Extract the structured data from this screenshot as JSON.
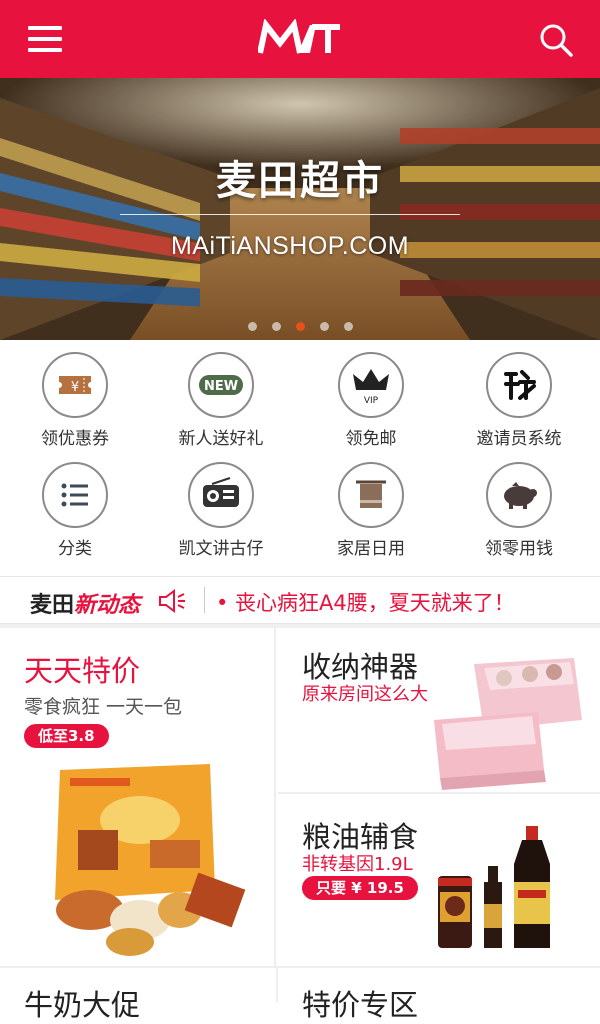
{
  "header": {
    "brand_color": "#e8123e",
    "logo_text": "MAT",
    "menu_icon": "hamburger-icon",
    "search_icon": "search-icon"
  },
  "banner": {
    "title": "麦田超市",
    "subtitle": "MAiTiANSHOP.COM",
    "active_slide": 3,
    "slide_count": 5
  },
  "grid": {
    "items": [
      {
        "label": "领优惠券",
        "icon": "coupon-icon"
      },
      {
        "label": "新人送好礼",
        "icon": "new-badge-icon"
      },
      {
        "label": "领免邮",
        "icon": "vip-crown-icon"
      },
      {
        "label": "邀请员系统",
        "icon": "invite-icon"
      },
      {
        "label": "分类",
        "icon": "list-icon"
      },
      {
        "label": "凯文讲古仔",
        "icon": "radio-icon"
      },
      {
        "label": "家居日用",
        "icon": "towel-icon"
      },
      {
        "label": "领零用钱",
        "icon": "piggy-bank-icon"
      }
    ]
  },
  "news": {
    "brand_black": "麦田",
    "brand_red": "新动态",
    "headline": "• 丧心病狂A4腰，夏天就来了！"
  },
  "promos": {
    "left": {
      "title": "天天特价",
      "subtitle": "零食疯狂 一天一包",
      "badge": "低至3.8"
    },
    "right_top": {
      "title": "收纳神器",
      "subtitle": "原来房间这么大"
    },
    "right_bottom": {
      "title": "粮油辅食",
      "subtitle": "非转基因1.9L",
      "badge": "只要 ¥ 19.5"
    }
  },
  "bottom": {
    "left": "牛奶大促",
    "right": "特价专区"
  }
}
